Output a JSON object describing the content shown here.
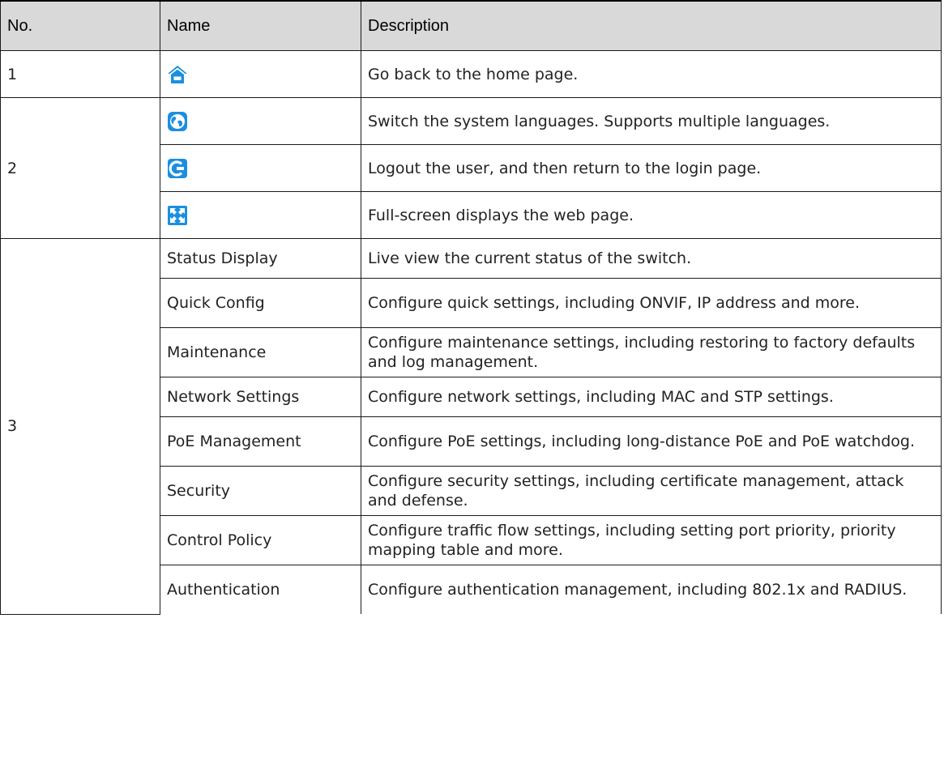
{
  "table": {
    "headers": [
      "No.",
      "Name",
      "Description"
    ],
    "rows": [
      {
        "no": "1",
        "name_icon": "home-icon",
        "description": "Go back to the home page."
      },
      {
        "no": "2",
        "name_icon": "globe-icon",
        "description": "Switch the system languages. Supports multiple languages."
      },
      {
        "name_icon": "logout-icon",
        "description": "Logout the user, and then return to the login page."
      },
      {
        "name_icon": "fullscreen-icon",
        "description": "Full-screen displays the web page."
      },
      {
        "no": "3",
        "name": "Status Display",
        "description": "Live view the current status of the switch."
      },
      {
        "name": "Quick Config",
        "description": "Configure quick settings, including ONVIF, IP address and more."
      },
      {
        "name": "Maintenance",
        "description": "Configure maintenance settings, including restoring to factory defaults and log management."
      },
      {
        "name": "Network Settings",
        "description": "Configure network settings, including MAC and STP settings."
      },
      {
        "name": "PoE Management",
        "description": "Configure PoE settings, including long-distance PoE and PoE watchdog."
      },
      {
        "name": "Security",
        "description": "Configure security settings, including certificate management, attack and defense."
      },
      {
        "name": "Control Policy",
        "description": "Configure traffic flow settings, including setting port priority, priority mapping table and more."
      },
      {
        "name": "Authentication",
        "description": "Configure authentication management, including 802.1x and RADIUS."
      }
    ]
  },
  "colors": {
    "icon_blue": "#1a8fe0",
    "header_bg": "#d9d9d9"
  }
}
